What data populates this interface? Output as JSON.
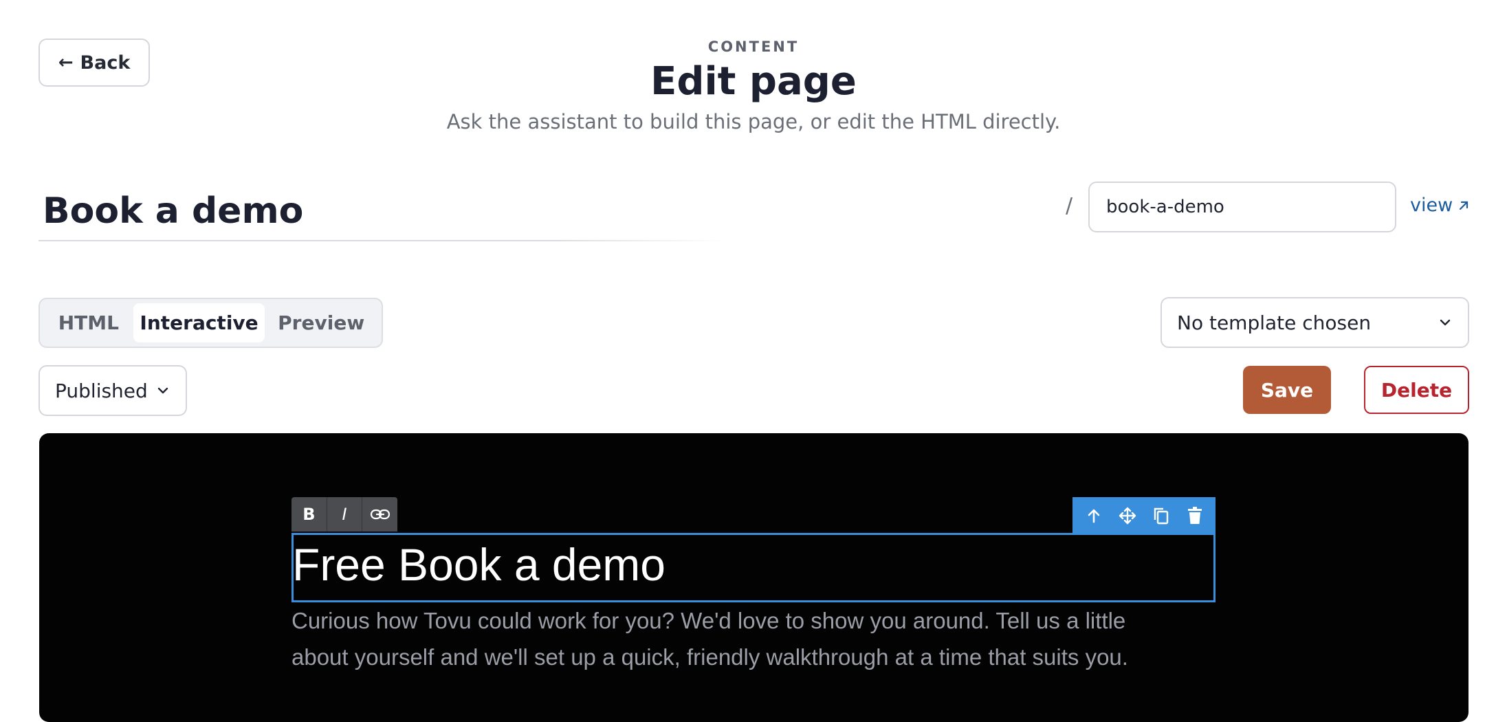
{
  "header": {
    "back_label": "Back",
    "eyebrow": "CONTENT",
    "title": "Edit page",
    "subtitle": "Ask the assistant to build this page, or edit the HTML directly."
  },
  "page": {
    "title": "Book a demo",
    "slug_prefix": "/",
    "slug": "book-a-demo",
    "view_label": "view"
  },
  "tabs": [
    {
      "label": "HTML",
      "active": false
    },
    {
      "label": "Interactive",
      "active": true
    },
    {
      "label": "Preview",
      "active": false
    }
  ],
  "template_select": {
    "value": "No template chosen"
  },
  "status_select": {
    "value": "Published"
  },
  "actions": {
    "save_label": "Save",
    "delete_label": "Delete"
  },
  "editor": {
    "format_toolbar": [
      {
        "label": "B",
        "icon": "bold-icon"
      },
      {
        "label": "I",
        "icon": "italic-icon"
      },
      {
        "label": "",
        "icon": "link-icon"
      }
    ],
    "block_toolbar_icons": [
      "arrow-up-icon",
      "move-icon",
      "duplicate-icon",
      "trash-icon"
    ],
    "heading": "Free Book a demo",
    "body": "Curious how Tovu could work for you? We'd love to show you around. Tell us a little about yourself and we'll set up a quick, friendly walkthrough at a time that suits you."
  },
  "colors": {
    "accent": "#b35a36",
    "danger": "#b8242e",
    "link": "#1b5c9e",
    "selection": "#3a8fdc",
    "canvas": "#030304"
  }
}
